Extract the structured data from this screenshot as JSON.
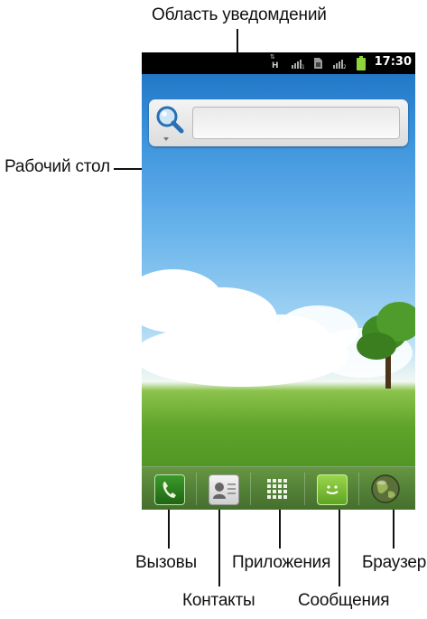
{
  "annotations": {
    "notification_area": "Область уведомдений",
    "desktop": "Рабочий стол",
    "calls": "Вызовы",
    "contacts": "Контакты",
    "apps": "Приложения",
    "messages": "Сообщения",
    "browser": "Браузер"
  },
  "status_bar": {
    "time": "17:30",
    "network_type": "H",
    "icons": [
      "data-arrows-icon",
      "signal-icon-sim1",
      "sim-icon",
      "signal-icon-sim2",
      "battery-icon"
    ]
  },
  "dock": {
    "items": [
      {
        "name": "phone-icon"
      },
      {
        "name": "contacts-icon"
      },
      {
        "name": "apps-grid-icon"
      },
      {
        "name": "messages-icon"
      },
      {
        "name": "browser-globe-icon"
      }
    ]
  },
  "colors": {
    "status_bar": "#000000",
    "phone_green": "#2e8a1f",
    "messages_green": "#7cc23a"
  }
}
